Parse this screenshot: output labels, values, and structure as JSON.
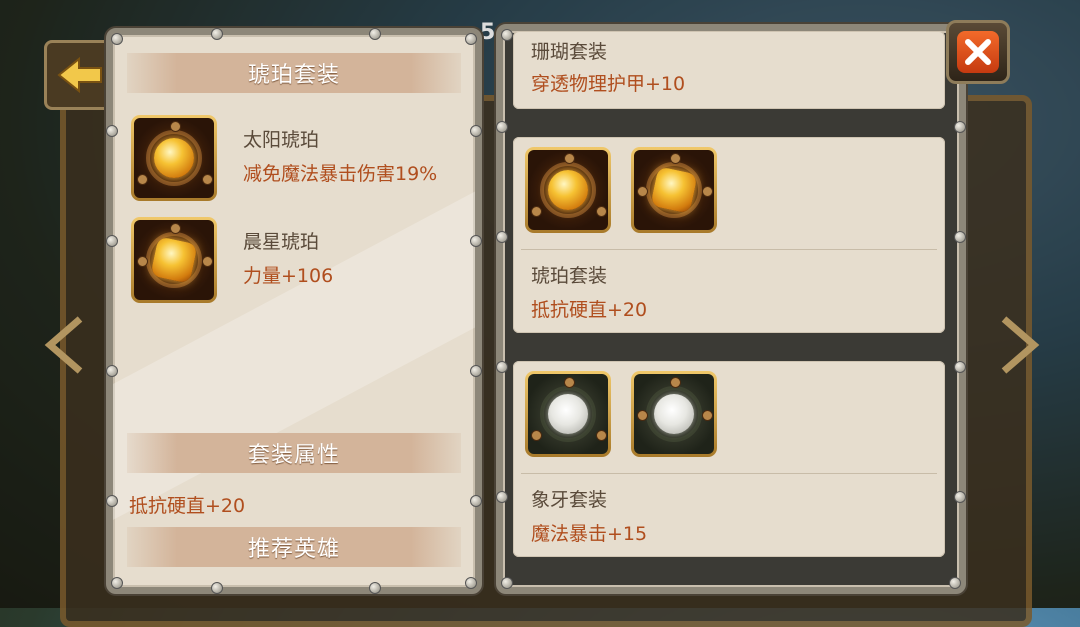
{
  "left_panel": {
    "header_title": "琥珀套装",
    "items": [
      {
        "name": "太阳琥珀",
        "stat": "减免魔法暴击伤害19%",
        "icon": "sun-amber-gem-icon"
      },
      {
        "name": "晨星琥珀",
        "stat": "力量+106",
        "icon": "morningstar-amber-gem-icon"
      }
    ],
    "set_attr_title": "套装属性",
    "set_attr_value": "抵抗硬直+20",
    "recommend_title": "推荐英雄"
  },
  "right_panel": {
    "cards": [
      {
        "name": "珊瑚套装",
        "stat": "穿透物理护甲+10"
      },
      {
        "name": "琥珀套装",
        "stat": "抵抗硬直+20",
        "gems": [
          "amber-gem-icon",
          "amber-gem-icon"
        ]
      },
      {
        "name": "象牙套装",
        "stat": "魔法暴击+15",
        "gems": [
          "ivory-flower-gem-icon",
          "ivory-rose-gem-icon"
        ]
      }
    ]
  },
  "background": {
    "partial_number": "5"
  },
  "colors": {
    "stat_text": "#b04e1e",
    "name_text": "#5a4a3a",
    "header_band": "#d3b49a",
    "close_button": "#e0521c"
  }
}
